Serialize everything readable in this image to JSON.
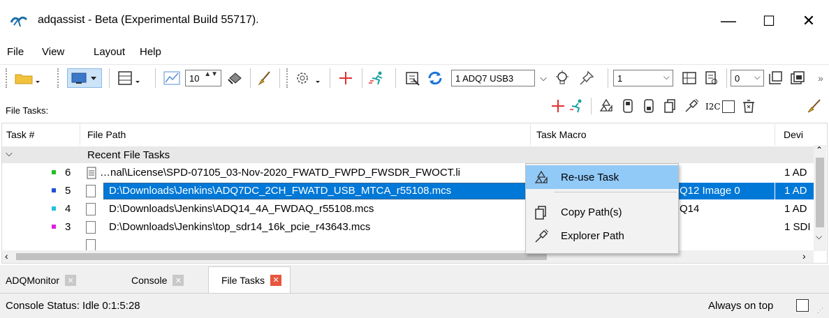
{
  "window": {
    "title": "adqassist - Beta (Experimental Build 55717).",
    "minimize": "—",
    "maximize": "☐",
    "close": "✕"
  },
  "menu": [
    "File",
    "View",
    "Layout",
    "Help"
  ],
  "toolbar": {
    "spin_value": "10",
    "device_combo": "1 ADQ7 USB3",
    "channel_combo": "1",
    "index_combo": "0",
    "overflow": "»"
  },
  "file_tasks": {
    "label": "File Tasks:",
    "i2c_label": "I2C"
  },
  "table": {
    "columns": [
      "Task #",
      "File Path",
      "Task Macro",
      "Devi"
    ],
    "group_label": "Recent File Tasks",
    "rows": [
      {
        "num": "6",
        "color": "#22c022",
        "path": "…nal\\License\\SPD-07105_03-Nov-2020_FWATD_FWPD_FWSDR_FWOCT.li",
        "macro": "",
        "device": "1 AD"
      },
      {
        "num": "5",
        "color": "#1f4fd8",
        "path": "D:\\Downloads\\Jenkins\\ADQ7DC_2CH_FWATD_USB_MTCA_r55108.mcs",
        "macro": "Q12 Image 0",
        "device": "1 AD",
        "selected": true
      },
      {
        "num": "4",
        "color": "#22c0e0",
        "path": "D:\\Downloads\\Jenkins\\ADQ14_4A_FWDAQ_r55108.mcs",
        "macro": "Q14",
        "device": "1 AD"
      },
      {
        "num": "3",
        "color": "#e020e0",
        "path": "D:\\Downloads\\Jenkins\\top_sdr14_16k_pcie_r43643.mcs",
        "macro": "",
        "device": "1 SDI"
      }
    ]
  },
  "context_menu": {
    "items": [
      "Re-use Task",
      "Copy Path(s)",
      "Explorer Path"
    ]
  },
  "tabs": [
    {
      "label": "ADQMonitor",
      "active": false
    },
    {
      "label": "Console",
      "active": false
    },
    {
      "label": "File Tasks",
      "active": true
    }
  ],
  "status": {
    "text": "Console Status: Idle 0:1:5:28",
    "always_on_top": "Always on top"
  },
  "colors": {
    "selection": "#0078d7",
    "menu_highlight": "#91c9f7",
    "accent_red": "#e03030",
    "tab_close_active": "#e8553e"
  }
}
